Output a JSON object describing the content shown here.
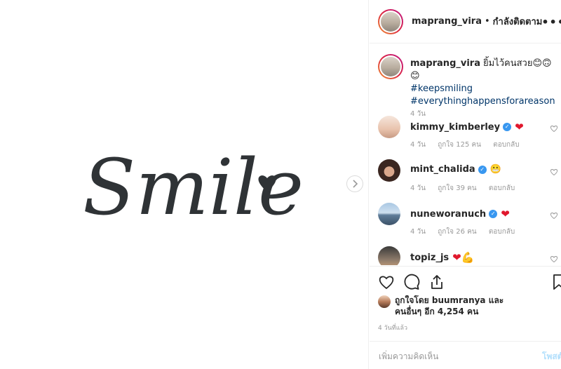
{
  "post": {
    "username": "maprang_vira",
    "separator": "•",
    "follow_label": "กำลังติดตาม",
    "more_label": "•••",
    "image_text": "Smile"
  },
  "caption": {
    "username": "maprang_vira",
    "text": "ยิ้มไว้คนสวย",
    "emojis": "😊🙃😊",
    "hashtags": [
      "#keepsmiling",
      "#everythinghappensforareason"
    ],
    "time": "4 วัน"
  },
  "comments": [
    {
      "username": "kimmy_kimberley",
      "verified": true,
      "emoji": "❤",
      "time": "4 วัน",
      "likes": "ถูกใจ 125 คน",
      "reply": "ตอบกลับ"
    },
    {
      "username": "mint_chalida",
      "verified": true,
      "emoji": "😬",
      "time": "4 วัน",
      "likes": "ถูกใจ 39 คน",
      "reply": "ตอบกลับ"
    },
    {
      "username": "nuneworanuch",
      "verified": true,
      "emoji": "❤",
      "time": "4 วัน",
      "likes": "ถูกใจ 26 คน",
      "reply": "ตอบกลับ"
    },
    {
      "username": "topiz_js",
      "verified": false,
      "emoji": "❤💪",
      "time": "",
      "likes": "",
      "reply": ""
    }
  ],
  "likes": {
    "line1": "ถูกใจโดย buumranya และ",
    "line2": "คนอื่นๆ อีก 4,254 คน"
  },
  "posted_time": "4 วันที่แล้ว",
  "add_comment": {
    "placeholder": "เพิ่มความคิดเห็น",
    "post_label": "โพสต์"
  },
  "icons": [
    "heart-icon",
    "comment-icon",
    "share-icon",
    "bookmark-icon",
    "chevron-right-icon",
    "verified-icon"
  ],
  "colors": {
    "hashtag": "#003569",
    "verified": "#3897f0",
    "heart": "#e0182d",
    "post_disabled": "#b2dffc"
  }
}
